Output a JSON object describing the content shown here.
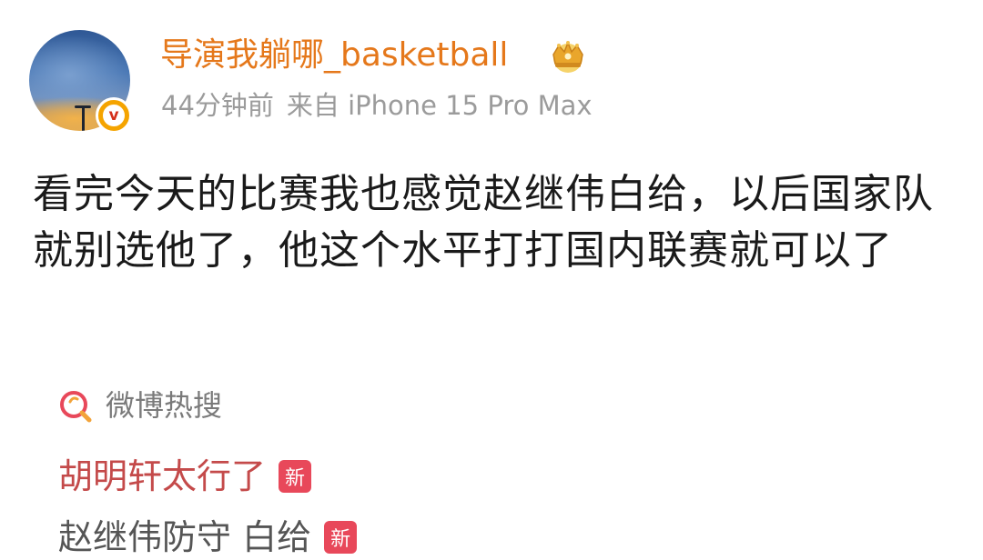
{
  "post": {
    "username": "导演我躺哪_basketball",
    "time_ago": "44分钟前",
    "source": "来自 iPhone 15 Pro Max",
    "content": "看完今天的比赛我也感觉赵继伟白给，以后国家队就别选他了，他这个水平打打国内联赛就可以了",
    "avatar_badge": "v",
    "crown_icon": "gold-crown-badge-icon"
  },
  "hot_search": {
    "title": "微博热搜",
    "icon": "weibo-hot-search-icon",
    "items": [
      {
        "text": "胡明轩太行了",
        "badge": "新"
      },
      {
        "text": "赵继伟防守 白给",
        "badge": "新"
      }
    ]
  },
  "colors": {
    "username": "#e5781b",
    "meta": "#9b9b9b",
    "hot_item": "#c44a4a",
    "new_badge": "#e8485a",
    "verified_badge": "#f5a400"
  }
}
